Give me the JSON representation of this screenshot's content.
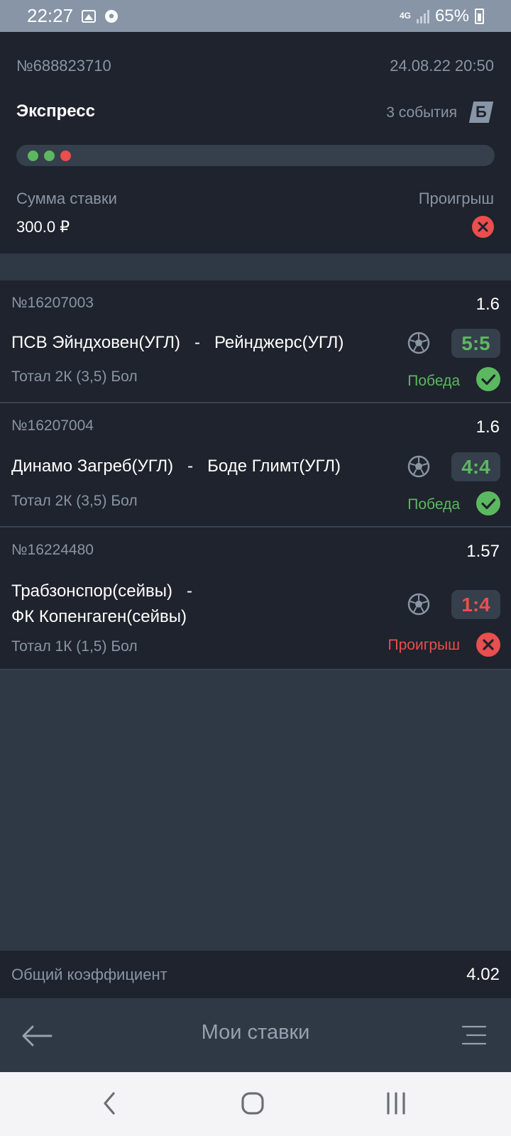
{
  "status_bar": {
    "time": "22:27",
    "network": "4G",
    "battery": "65%",
    "icons": [
      "image-icon",
      "soccer-ball-icon",
      "signal-icon",
      "battery-icon"
    ]
  },
  "bet": {
    "id": "№688823710",
    "date": "24.08.22 20:50",
    "type": "Экспресс",
    "events_count": "3 события",
    "badge": "Б",
    "stake_label": "Сумма ставки",
    "stake_value": "300.0 ₽",
    "result_label": "Проигрыш",
    "progress_dots": [
      "win",
      "win",
      "loss"
    ]
  },
  "events": [
    {
      "id": "№16207003",
      "odd": "1.6",
      "teams": "ПСВ Эйндховен(УГЛ)   -   Рейнджерс(УГЛ)",
      "market": "Тотал 2К (3,5) Бол",
      "score": "5:5",
      "status": "Победа",
      "result": "win"
    },
    {
      "id": "№16207004",
      "odd": "1.6",
      "teams": "Динамо Загреб(УГЛ)   -   Боде Глимт(УГЛ)",
      "market": "Тотал 2К (3,5) Бол",
      "score": "4:4",
      "status": "Победа",
      "result": "win"
    },
    {
      "id": "№16224480",
      "odd": "1.57",
      "teams": "Трабзонспор(сейвы)   -\nФК Копенгаген(сейвы)",
      "market": "Тотал 1К (1,5) Бол",
      "score": "1:4",
      "status": "Проигрыш",
      "result": "loss"
    }
  ],
  "total": {
    "label": "Общий коэффициент",
    "value": "4.02"
  },
  "nav": {
    "title": "Мои ставки"
  },
  "colors": {
    "win": "#5cb860",
    "loss": "#ea4e4e",
    "card_bg": "#1e232d",
    "page_bg": "#2f3845",
    "muted": "#8a95a3"
  }
}
